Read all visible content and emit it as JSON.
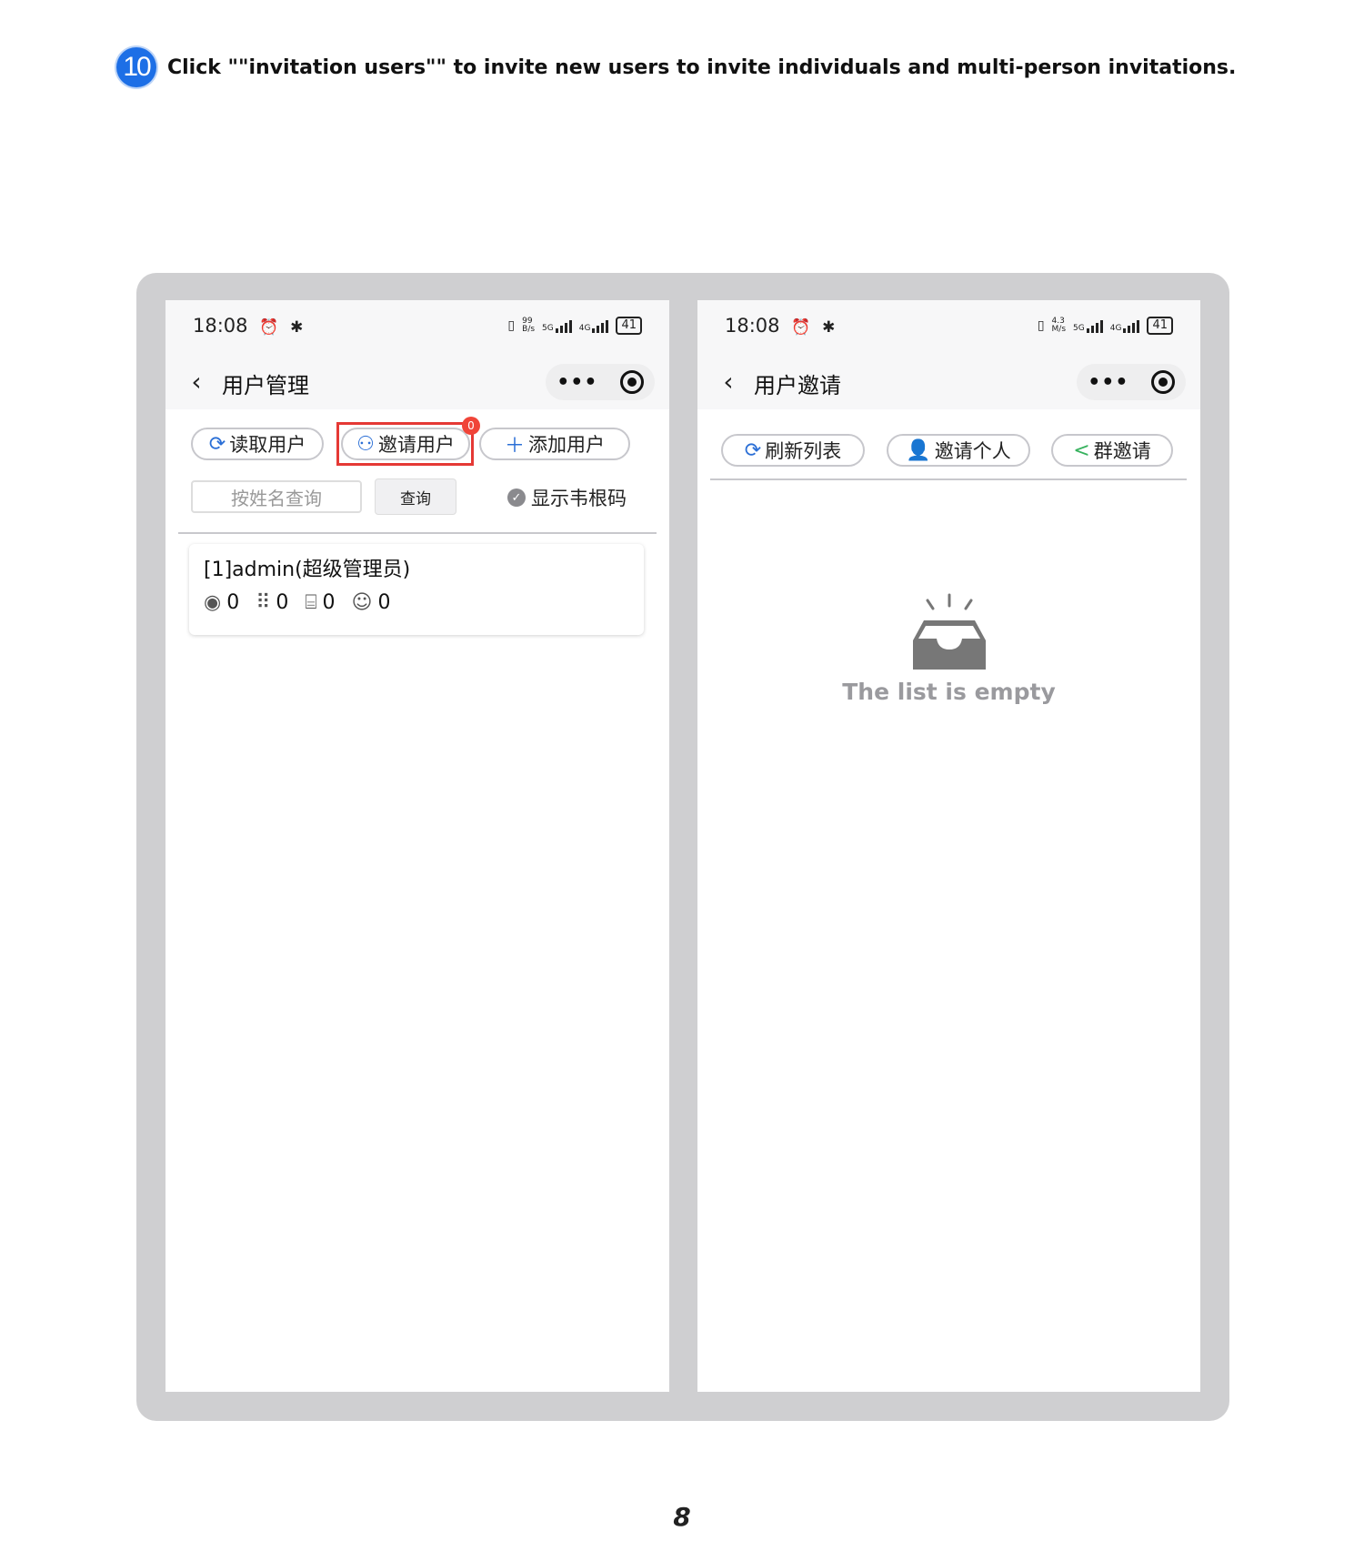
{
  "step": {
    "number": "10",
    "text": "Click \"\"invitation users\"\" to invite new users to invite individuals and multi-person invitations."
  },
  "left_screen": {
    "status": {
      "time": "18:08",
      "battery": "41",
      "speed_top": "99",
      "speed_bottom": "B/s",
      "net1": "5G",
      "net2": "4G"
    },
    "nav_title": "用户管理",
    "buttons": {
      "read": "读取用户",
      "invite": "邀请用户",
      "add": "添加用户"
    },
    "invite_badge": "0",
    "search_placeholder": "按姓名查询",
    "query_label": "查询",
    "show_toggle_label": "显示韦根码",
    "user": {
      "name": "[1]admin(超级管理员)",
      "stats": [
        {
          "icon": "fingerprint-icon",
          "value": "0"
        },
        {
          "icon": "keypad-icon",
          "value": "0"
        },
        {
          "icon": "card-icon",
          "value": "0"
        },
        {
          "icon": "face-icon",
          "value": "0"
        }
      ]
    }
  },
  "right_screen": {
    "status": {
      "time": "18:08",
      "battery": "41",
      "speed_top": "4.3",
      "speed_bottom": "M/s",
      "net1": "5G",
      "net2": "4G"
    },
    "nav_title": "用户邀请",
    "buttons": {
      "refresh": "刷新列表",
      "invite_person": "邀请个人",
      "group_invite": "群邀请"
    },
    "empty_text": "The list is empty"
  },
  "page_number": "8",
  "colors": {
    "accent": "#2b6fd6",
    "highlight": "#e53935",
    "badge": "#f04438",
    "frame": "#cfcfd1"
  }
}
